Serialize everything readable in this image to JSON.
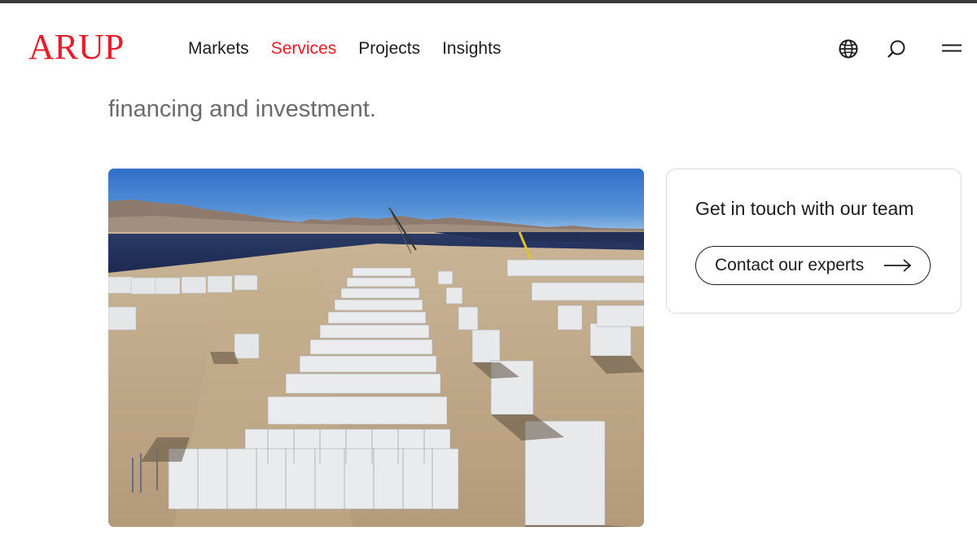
{
  "header": {
    "logo": "ARUP",
    "nav": [
      {
        "label": "Markets",
        "active": false
      },
      {
        "label": "Services",
        "active": true
      },
      {
        "label": "Projects",
        "active": false
      },
      {
        "label": "Insights",
        "active": false
      }
    ],
    "icons": [
      "globe-icon",
      "search-icon",
      "menu-icon"
    ]
  },
  "intro_text": "financing and investment.",
  "photo": {
    "subject": "battery-storage-facility-photo"
  },
  "contact_card": {
    "title": "Get in touch with our team",
    "button_label": "Contact our experts",
    "button_icon": "arrow-right-icon"
  },
  "colors": {
    "brand_red": "#e61e2a",
    "text": "#1c1c1c",
    "intro_gray": "#6b6b6b",
    "card_border": "#d9d9d9"
  }
}
